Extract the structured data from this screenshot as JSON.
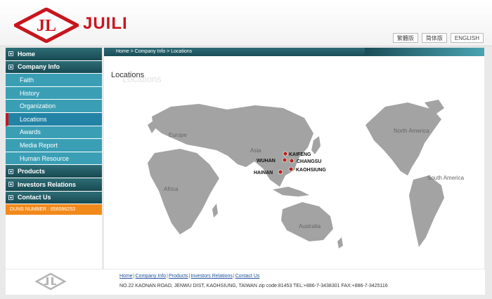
{
  "header": {
    "brand": "JUILI",
    "logo_letters": "JL",
    "languages": [
      "繁體版",
      "简体版",
      "ENGLISH"
    ]
  },
  "nav": {
    "items": [
      {
        "label": "Home",
        "level": "top"
      },
      {
        "label": "Company Info",
        "level": "top"
      },
      {
        "label": "Faith",
        "level": "sub"
      },
      {
        "label": "History",
        "level": "sub"
      },
      {
        "label": "Organization",
        "level": "sub"
      },
      {
        "label": "Locations",
        "level": "sub",
        "active": true
      },
      {
        "label": "Awards",
        "level": "sub"
      },
      {
        "label": "Media Report",
        "level": "sub"
      },
      {
        "label": "Human Resource",
        "level": "sub"
      },
      {
        "label": "Products",
        "level": "top"
      },
      {
        "label": "Investors Relations",
        "level": "top"
      },
      {
        "label": "Contact Us",
        "level": "top"
      }
    ],
    "duns": "DUNS NUMBER : 656086253"
  },
  "main": {
    "breadcrumb": "Home > Company Info > Locations",
    "title": "Locations",
    "title_shadow": "Locations"
  },
  "map": {
    "regions": [
      "Europe",
      "Asia",
      "Africa",
      "Australia",
      "North America",
      "South America"
    ],
    "locations": [
      "KAIFENG",
      "WUHAN",
      "CHANGSU",
      "HAINAN",
      "KAOHSIUNG"
    ]
  },
  "footer": {
    "links": [
      "Home",
      "Company Info",
      "Products",
      "Investors Relations",
      "Contact Us"
    ],
    "address": "NO.22 KAONAN ROAD, JENWU DIST, KAOHSIUNG, TAIWAN zip code:81453 TEL:+886-7-3438301 FAX:+886-7-3425116"
  },
  "colors": {
    "brand_red": "#c8161d",
    "nav_dark": "#1f525b",
    "nav_sub": "#3a9fb5",
    "duns_orange": "#f28a1b",
    "link_blue": "#1f4f9a"
  }
}
